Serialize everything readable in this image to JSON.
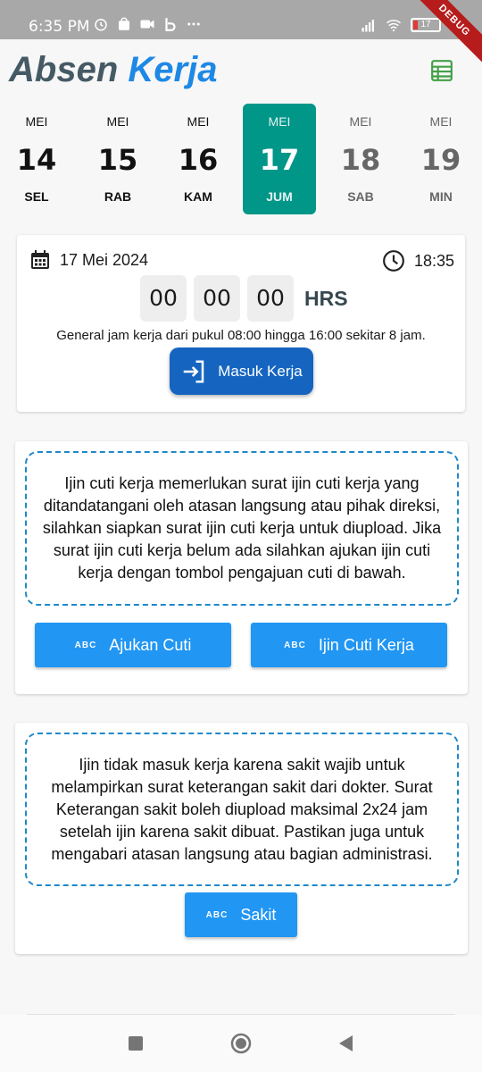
{
  "status_bar": {
    "time": "6:35 PM",
    "battery": "17",
    "debug_label": "DEBUG"
  },
  "header": {
    "title_part1": "Absen",
    "title_part2": "Kerja",
    "accent_color": "#1e88e5",
    "icon": "spreadsheet-icon"
  },
  "dates": [
    {
      "month": "MEI",
      "day": "14",
      "weekday": "SEL",
      "state": "past"
    },
    {
      "month": "MEI",
      "day": "15",
      "weekday": "RAB",
      "state": "past"
    },
    {
      "month": "MEI",
      "day": "16",
      "weekday": "KAM",
      "state": "past"
    },
    {
      "month": "MEI",
      "day": "17",
      "weekday": "JUM",
      "state": "selected"
    },
    {
      "month": "MEI",
      "day": "18",
      "weekday": "SAB",
      "state": "future"
    },
    {
      "month": "MEI",
      "day": "19",
      "weekday": "MIN",
      "state": "future"
    }
  ],
  "attendance": {
    "date": "17 Mei 2024",
    "time": "18:35",
    "timer": {
      "h": "00",
      "m": "00",
      "s": "00",
      "unit": "HRS"
    },
    "work_hours_note": "General jam kerja dari pukul 08:00 hingga 16:00 sekitar 8 jam.",
    "checkin_label": "Masuk Kerja"
  },
  "leave": {
    "info": "Ijin cuti kerja memerlukan surat ijin cuti kerja yang ditandatangani oleh atasan langsung atau pihak direksi, silahkan siapkan surat ijin cuti kerja untuk diupload. Jika surat ijin cuti kerja belum ada silahkan ajukan ijin cuti kerja dengan tombol pengajuan cuti di bawah.",
    "btn_apply_label": "Ajukan Cuti",
    "btn_permit_label": "Ijin Cuti Kerja",
    "btn_icon_text": "ABC"
  },
  "sick": {
    "info": "Ijin tidak masuk kerja karena sakit wajib untuk melampirkan surat keterangan sakit dari dokter. Surat Keterangan sakit boleh diupload maksimal 2x24 jam setelah ijin karena sakit dibuat. Pastikan juga untuk mengabari atasan langsung atau bagian administrasi.",
    "btn_label": "Sakit",
    "btn_icon_text": "ABC"
  },
  "colors": {
    "selected_day": "#009688",
    "primary_button": "#1565c0",
    "secondary_button": "#2196f3",
    "dashed_border": "#1e88c8"
  }
}
